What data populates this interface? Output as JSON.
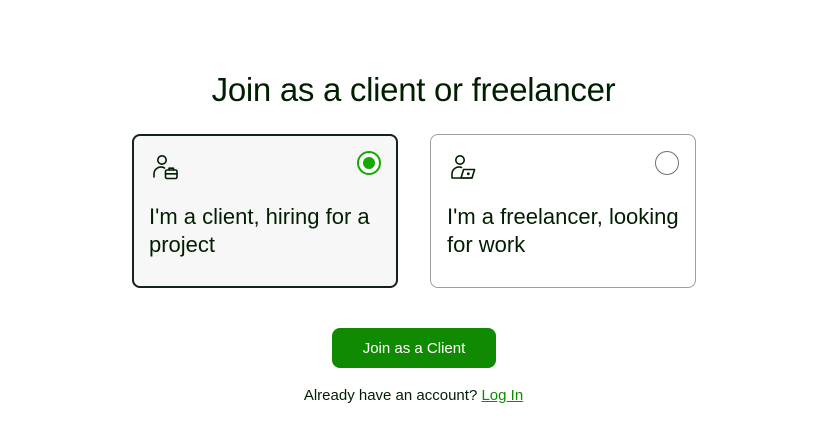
{
  "page": {
    "title": "Join as a client or freelancer"
  },
  "options": [
    {
      "id": "client",
      "label": "I'm a client, hiring for a project",
      "icon": "client-briefcase-icon",
      "selected": true
    },
    {
      "id": "freelancer",
      "label": "I'm a freelancer, looking for work",
      "icon": "freelancer-laptop-icon",
      "selected": false
    }
  ],
  "cta": {
    "label": "Join as a Client"
  },
  "login": {
    "prompt": "Already have an account?",
    "link_label": "Log In"
  },
  "colors": {
    "brand_green": "#14a800",
    "button_green": "#108a00",
    "text_dark": "#001e00"
  }
}
